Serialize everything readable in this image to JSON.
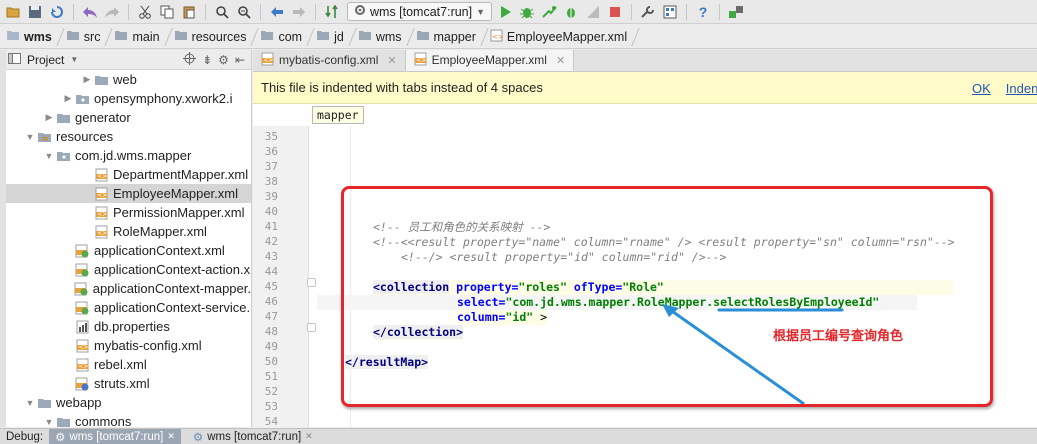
{
  "toolbar": {
    "run_config_label": "wms [tomcat7:run]"
  },
  "breadcrumb": [
    "wms",
    "src",
    "main",
    "resources",
    "com",
    "jd",
    "wms",
    "mapper",
    "EmployeeMapper.xml"
  ],
  "project_panel": {
    "title": "Project",
    "tree": [
      {
        "label": "web",
        "indent": 5,
        "arrow": "▶",
        "icon": "folder-icon",
        "selected": false
      },
      {
        "label": "opensymphony.xwork2.i",
        "indent": 4,
        "arrow": "▶",
        "icon": "package-icon",
        "selected": false
      },
      {
        "label": "generator",
        "indent": 3,
        "arrow": "▶",
        "icon": "folder-icon",
        "selected": false
      },
      {
        "label": "resources",
        "indent": 2,
        "arrow": "▼",
        "icon": "resources-folder-icon",
        "selected": false
      },
      {
        "label": "com.jd.wms.mapper",
        "indent": 3,
        "arrow": "▼",
        "icon": "package-icon",
        "selected": false
      },
      {
        "label": "DepartmentMapper.xml",
        "indent": 5,
        "arrow": "",
        "icon": "xml-file-icon",
        "selected": false
      },
      {
        "label": "EmployeeMapper.xml",
        "indent": 5,
        "arrow": "",
        "icon": "xml-file-icon",
        "selected": true
      },
      {
        "label": "PermissionMapper.xml",
        "indent": 5,
        "arrow": "",
        "icon": "xml-file-icon",
        "selected": false
      },
      {
        "label": "RoleMapper.xml",
        "indent": 5,
        "arrow": "",
        "icon": "xml-file-icon",
        "selected": false
      },
      {
        "label": "applicationContext.xml",
        "indent": 4,
        "arrow": "",
        "icon": "spring-xml-icon",
        "selected": false
      },
      {
        "label": "applicationContext-action.x",
        "indent": 4,
        "arrow": "",
        "icon": "spring-xml-icon",
        "selected": false
      },
      {
        "label": "applicationContext-mapper.",
        "indent": 4,
        "arrow": "",
        "icon": "spring-xml-icon",
        "selected": false
      },
      {
        "label": "applicationContext-service.",
        "indent": 4,
        "arrow": "",
        "icon": "spring-xml-icon",
        "selected": false
      },
      {
        "label": "db.properties",
        "indent": 4,
        "arrow": "",
        "icon": "properties-file-icon",
        "selected": false
      },
      {
        "label": "mybatis-config.xml",
        "indent": 4,
        "arrow": "",
        "icon": "xml-file-icon",
        "selected": false
      },
      {
        "label": "rebel.xml",
        "indent": 4,
        "arrow": "",
        "icon": "xml-file-icon",
        "selected": false
      },
      {
        "label": "struts.xml",
        "indent": 4,
        "arrow": "",
        "icon": "struts-xml-icon",
        "selected": false
      },
      {
        "label": "webapp",
        "indent": 2,
        "arrow": "▼",
        "icon": "folder-icon",
        "selected": false
      },
      {
        "label": "commons",
        "indent": 3,
        "arrow": "▼",
        "icon": "folder-icon",
        "selected": false
      }
    ]
  },
  "editor": {
    "tabs": [
      {
        "label": "mybatis-config.xml",
        "active": false
      },
      {
        "label": "EmployeeMapper.xml",
        "active": true
      }
    ],
    "banner": {
      "message": "This file is indented with tabs instead of 4 spaces",
      "ok_label": "OK",
      "indent_label": "Indent"
    },
    "tag_crumb": "mapper",
    "line_numbers": [
      "35",
      "36",
      "37",
      "38",
      "39",
      "40",
      "41",
      "42",
      "43",
      "44",
      "45",
      "46",
      "47",
      "48",
      "49",
      "50",
      "51",
      "52",
      "53",
      "54"
    ],
    "code": {
      "l41": "<!-- 员工和角色的关系映射 -->",
      "l42": "<!--<<result property=\"name\" column=\"rname\" /> <result property=\"sn\" column=\"rsn\"-->",
      "l43": "<!--/> <result property=\"id\" column=\"rid\" />-->",
      "l45_tag": "<collection",
      "l45_a1": "property=",
      "l45_v1": "\"roles\"",
      "l45_a2": "ofType=",
      "l45_v2": "\"Role\"",
      "l46_a": "select=",
      "l46_v": "\"com.jd.wms.mapper.RoleMapper.selectRolesByEmployeeId\"",
      "l47_a": "column=",
      "l47_v": "\"id\"",
      "l47_end": " >",
      "l48": "</collection>",
      "l50": "</resultMap>"
    },
    "annotation": "根据员工编号查询角色",
    "colors": {
      "annotation_red": "#e5262a",
      "arrow_blue": "#2a8fd6"
    }
  },
  "statusbar": {
    "label": "Debug:",
    "tabs": [
      "wms [tomcat7:run]",
      "wms [tomcat7:run]"
    ]
  }
}
